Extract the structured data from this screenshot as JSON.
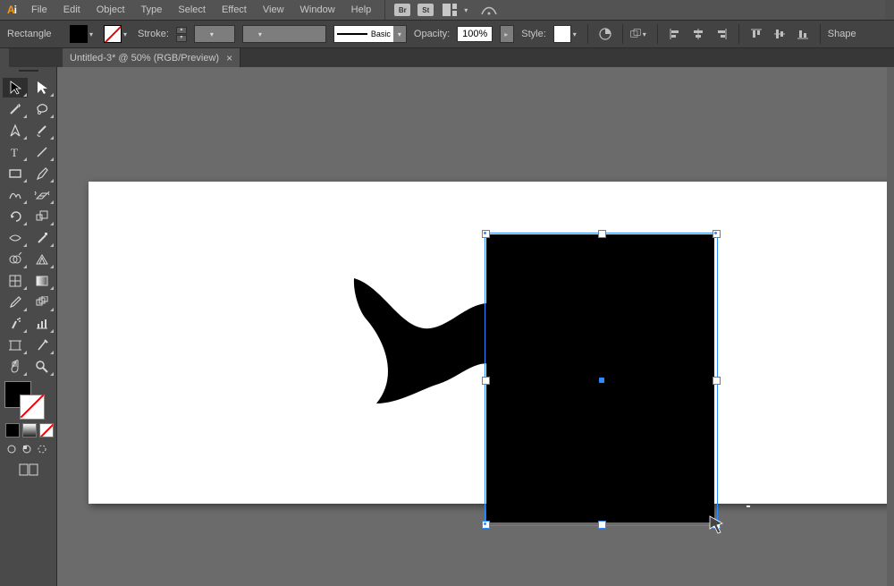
{
  "app": {
    "abbr_a": "A",
    "abbr_i": "i"
  },
  "menu": {
    "items": [
      "File",
      "Edit",
      "Object",
      "Type",
      "Select",
      "Effect",
      "View",
      "Window",
      "Help"
    ],
    "bridge_abbr": "Br",
    "stock_abbr": "St"
  },
  "control": {
    "tool_name": "Rectangle",
    "stroke_label": "Stroke:",
    "brush_style_label": "Basic",
    "opacity_label": "Opacity:",
    "opacity_value": "100%",
    "style_label": "Style:",
    "shape_label": "Shape"
  },
  "document": {
    "tab_title": "Untitled-3* @ 50% (RGB/Preview)"
  },
  "tools": {
    "names": [
      "selection-tool",
      "direct-selection-tool",
      "magic-wand-tool",
      "lasso-tool",
      "pen-tool",
      "curvature-tool",
      "type-tool",
      "line-segment-tool",
      "rectangle-tool",
      "paintbrush-tool",
      "shaper-tool",
      "eraser-tool",
      "rotate-tool",
      "scale-tool",
      "width-tool",
      "free-transform-tool",
      "shape-builder-tool",
      "perspective-grid-tool",
      "mesh-tool",
      "gradient-tool",
      "eyedropper-tool",
      "blend-tool",
      "symbol-sprayer-tool",
      "column-graph-tool",
      "artboard-tool",
      "slice-tool",
      "hand-tool",
      "zoom-tool"
    ]
  },
  "colors": {
    "fill": "#000000",
    "stroke": "none",
    "accent": "#2c8cff"
  }
}
